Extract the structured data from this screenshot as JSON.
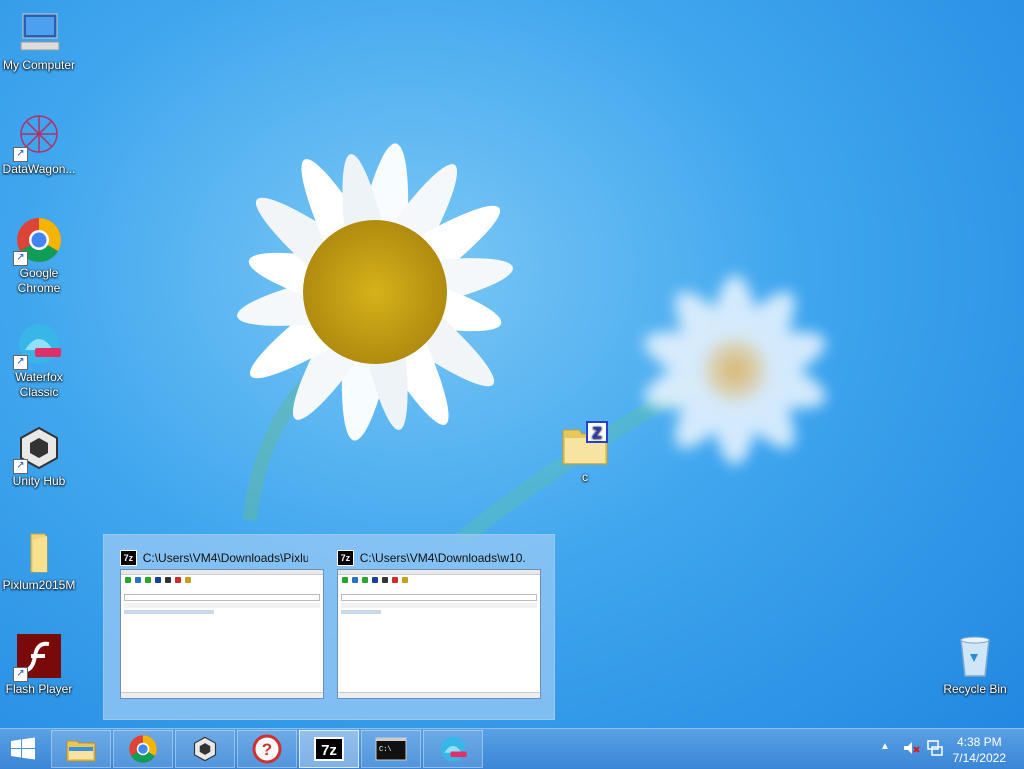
{
  "desktop": {
    "icons": [
      {
        "label": "My Computer"
      },
      {
        "label": "DataWagon..."
      },
      {
        "label": "Google Chrome"
      },
      {
        "label": "Waterfox Classic"
      },
      {
        "label": "Unity Hub"
      },
      {
        "label": "Pixlum2015M"
      },
      {
        "label": "Flash Player"
      },
      {
        "label": "Recycle Bin"
      },
      {
        "label": "c"
      }
    ]
  },
  "thumbnails": [
    {
      "title": "C:\\Users\\VM4\\Downloads\\Pixlu...",
      "icon": "7z-icon"
    },
    {
      "title": "C:\\Users\\VM4\\Downloads\\w10...",
      "icon": "7z-icon"
    }
  ],
  "taskbar": {
    "items": [
      "file-explorer",
      "google-chrome",
      "unity-hub",
      "help",
      "7-zip",
      "command-prompt",
      "waterfox"
    ],
    "active": "7-zip"
  },
  "tray": {
    "time": "4:38 PM",
    "date": "7/14/2022"
  },
  "colors": {
    "taskbar": "#3a86d6",
    "wallpaper": "#2f96e8"
  }
}
